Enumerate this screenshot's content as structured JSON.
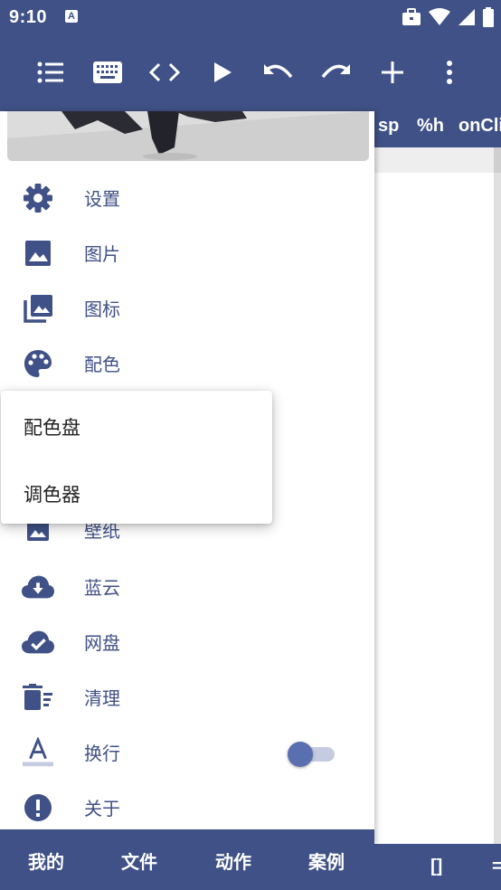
{
  "status_bar": {
    "time": "9:10",
    "notification_letter": "A"
  },
  "toolbar": {
    "icons": [
      "list-icon",
      "keyboard-icon",
      "code-icon",
      "play-icon",
      "undo-icon",
      "redo-icon",
      "add-icon",
      "more-vert-icon"
    ]
  },
  "editor": {
    "header_items": [
      "sp",
      "%h",
      "onCli"
    ],
    "bottom_symbols": [
      "[]",
      "="
    ]
  },
  "drawer": {
    "items": [
      {
        "label": "设置",
        "icon": "settings-icon"
      },
      {
        "label": "图片",
        "icon": "image-icon"
      },
      {
        "label": "图标",
        "icon": "photo-library-icon"
      },
      {
        "label": "配色",
        "icon": "palette-icon"
      },
      {
        "label": "壁纸",
        "icon": "wallpaper-icon"
      },
      {
        "label": "蓝云",
        "icon": "cloud-download-icon"
      },
      {
        "label": "网盘",
        "icon": "cloud-done-icon"
      },
      {
        "label": "清理",
        "icon": "delete-sweep-icon"
      },
      {
        "label": "换行",
        "icon": "text-format-icon",
        "toggle_on": true
      },
      {
        "label": "关于",
        "icon": "info-icon"
      }
    ]
  },
  "popup_menu": {
    "items": [
      "配色盘",
      "调色器"
    ]
  },
  "bottom_nav": {
    "tabs": [
      "我的",
      "文件",
      "动作",
      "案例"
    ]
  },
  "colors": {
    "primary": "#3f5186",
    "accent": "#5a6fb0",
    "surface": "#ffffff"
  }
}
